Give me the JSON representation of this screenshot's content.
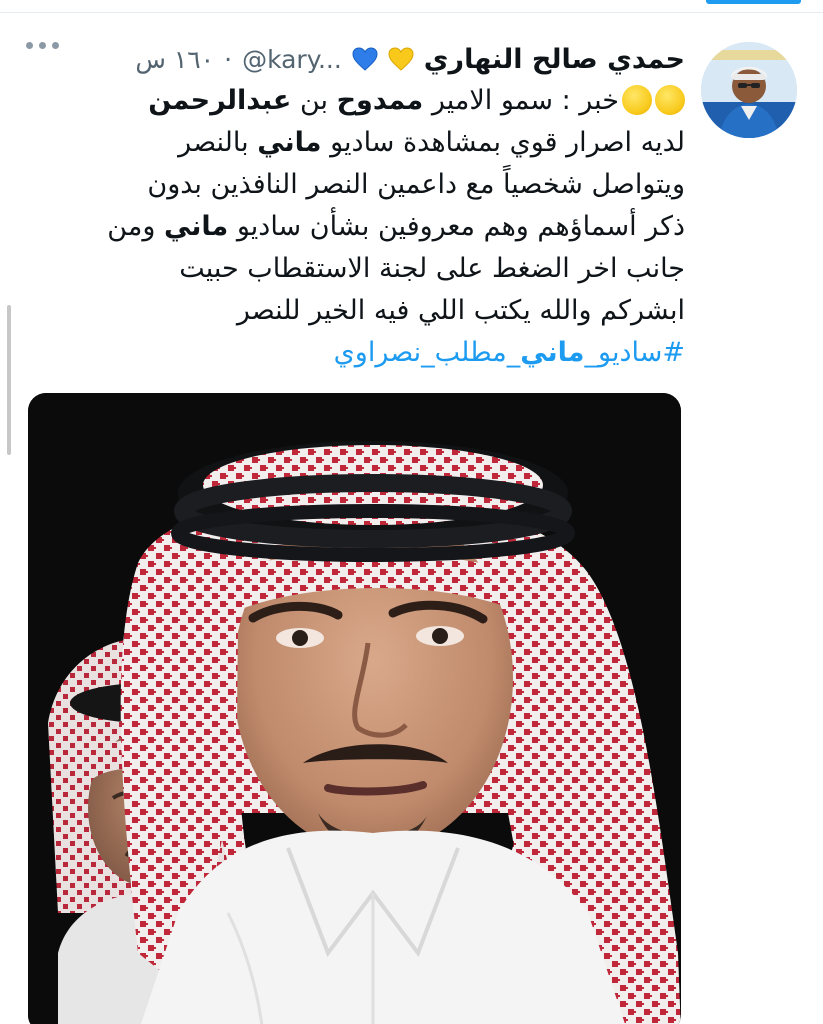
{
  "tweet": {
    "author": {
      "display_name": "حمدي صالح النهاري",
      "handle": "@kary...",
      "badges": [
        "yellow-heart-icon",
        "blue-heart-icon"
      ]
    },
    "time": "١٦٠ س",
    "text": {
      "line1_prefix": "خبر : سمو الامير ",
      "line1_bold1": "ممدوح",
      "line1_mid": " بن ",
      "line1_bold2": "عبدالرحمن",
      "line2_pre": "لديه اصرار قوي بمشاهدة ساديو ",
      "line2_bold": "ماني",
      "line2_post": " بالنصر",
      "line3": "ويتواصل شخصياً مع داعمين النصر النافذين بدون",
      "line4_pre": "ذكر أسماؤهم وهم معروفين بشأن ساديو ",
      "line4_bold": "ماني",
      "line4_post": " ومن",
      "line5": "جانب اخر الضغط على لجنة الاستقطاب حبيت",
      "line6": "ابشركم والله يكتب اللي فيه الخير للنصر",
      "hashtag_pre": "#ساديو_",
      "hashtag_bold": "ماني",
      "hashtag_post": "_مطلب_نصراوي"
    },
    "media": {
      "description_icon": "photo-image"
    }
  },
  "colors": {
    "link": "#1d9bf0",
    "secondary_text": "#536471",
    "primary_text": "#0f1419",
    "emoji_yellow": "#f8c91a"
  }
}
